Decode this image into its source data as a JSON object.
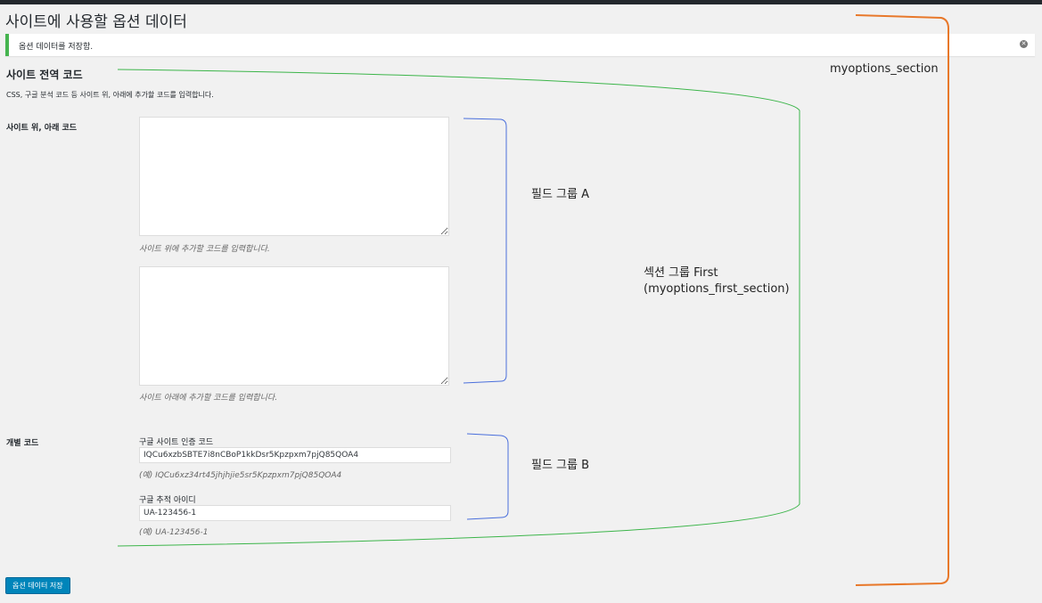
{
  "page": {
    "title": "사이트에 사용할 옵션 데이터"
  },
  "notice": {
    "text": "옵션 데이터를 저장함.",
    "dismiss_icon": "dismiss-icon"
  },
  "section": {
    "title": "사이트 전역 코드",
    "description": "CSS, 구글 분석 코드 등 사이트 위, 아래에 추가할 코드를 입력합니다."
  },
  "fields": {
    "site_code": {
      "label": "사이트 위, 아래 코드",
      "header": {
        "value": "",
        "description": "사이트 위에 추가할 코드를 입력합니다."
      },
      "footer": {
        "value": "",
        "description": "사이트 아래에 추가할 코드를 입력합니다."
      }
    },
    "individual": {
      "label": "개별 코드",
      "verification": {
        "label": "구글 사이트 인증 코드",
        "value": "IQCu6xzbSBTE7i8nCBoP1kkDsr5Kpzpxm7pjQ85QOA4",
        "description": "(예) IQCu6xz34rt45jhjhjie5sr5Kpzpxm7pjQ85QOA4"
      },
      "tracking": {
        "label": "구글 추적 아이디",
        "value": "UA-123456-1",
        "description": "(예) UA-123456-1"
      }
    }
  },
  "actions": {
    "submit_label": "옵션 데이터 저장"
  },
  "annotations": {
    "outer": "myoptions_section",
    "section_group": "섹션 그룹 First\n(myoptions_first_section)",
    "field_group_a": "필드 그룹 A",
    "field_group_b": "필드 그룹 B",
    "colors": {
      "orange": "#e8782a",
      "green": "#3cb54a",
      "blue": "#4a6fdc",
      "notice_border": "#46b450",
      "button": "#0085ba"
    }
  }
}
